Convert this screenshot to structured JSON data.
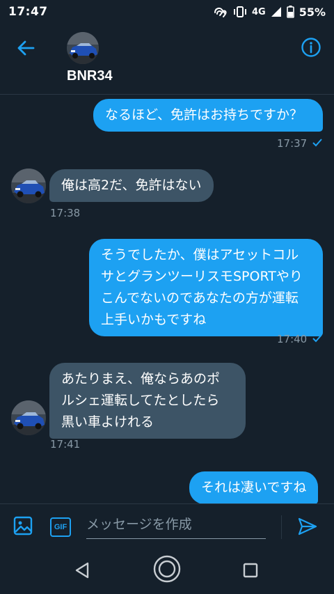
{
  "status_bar": {
    "time": "17:47",
    "network": "4G",
    "battery": "55%"
  },
  "header": {
    "name": "BNR34",
    "back_icon": "arrow-left-icon",
    "info_icon": "info-icon"
  },
  "messages": [
    {
      "direction": "out",
      "text": "なるほど、免許はお持ちですか？",
      "time": "17:37",
      "read": true
    },
    {
      "direction": "in",
      "text": "俺は高2だ、免許はない",
      "time": "17:38"
    },
    {
      "direction": "out",
      "text": "そうでしたか、僕はアセットコル\nサとグランツーリスモSPORTやり\nこんでないのであなたの方が運転\n上手いかもですね",
      "time": "17:40",
      "read": true
    },
    {
      "direction": "in",
      "text": "あたりまえ、俺ならあのポ\nルシェ運転してたとしたら\n黒い車よけれる",
      "time": "17:41"
    },
    {
      "direction": "out",
      "text": "それは凄いですね"
    }
  ],
  "composer": {
    "placeholder": "メッセージを作成",
    "gif_label": "GIF"
  },
  "colors": {
    "background": "#15202b",
    "accent": "#1da1f2",
    "incoming_bubble": "#3d5466",
    "muted": "#8899a6"
  }
}
